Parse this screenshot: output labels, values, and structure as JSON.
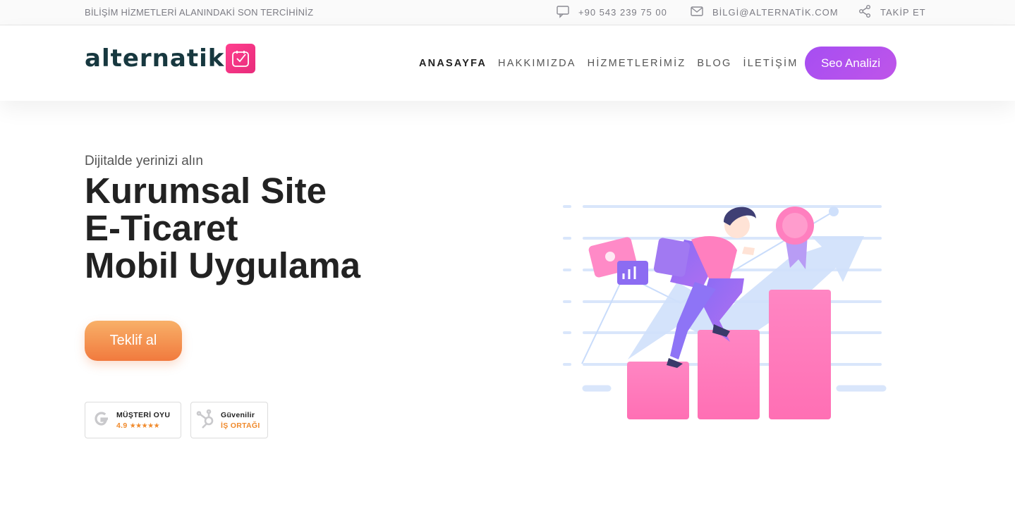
{
  "topbar": {
    "tagline": "BİLİŞİM HİZMETLERİ ALANINDAKİ SON TERCİHİNİZ",
    "phone": "+90 543 239 75 00",
    "email": "BİLGİ@ALTERNATİK.COM",
    "follow": "TAKİP ET",
    "icons": [
      "chat-icon",
      "mail-icon",
      "share-icon"
    ]
  },
  "header": {
    "logo_text": "alternatik",
    "nav": [
      {
        "label": "ANASAYFA",
        "active": true
      },
      {
        "label": "HAKKIMIZDA",
        "active": false
      },
      {
        "label": "HİZMETLERİMİZ",
        "active": false
      },
      {
        "label": "BLOG",
        "active": false
      },
      {
        "label": "İLETİŞİM",
        "active": false
      }
    ],
    "cta_label": "Seo Analizi"
  },
  "hero": {
    "subtitle": "Dijitalde yerinizi alın",
    "title_lines": [
      "Kurumsal Site",
      "E-Ticaret",
      "Mobil Uygulama"
    ],
    "button_label": "Teklif al"
  },
  "badges": {
    "google": {
      "title": "MÜŞTERİ OYU",
      "rating": "4.9",
      "stars": "★★★★★"
    },
    "partner": {
      "title": "Güvenilir",
      "subtitle": "İŞ ORTAĞI"
    }
  },
  "colors": {
    "accent_purple": "#a64ef2",
    "accent_orange": "#f17a3e",
    "brand_pink": "#ff3f8e",
    "logo_dark": "#17383f"
  }
}
